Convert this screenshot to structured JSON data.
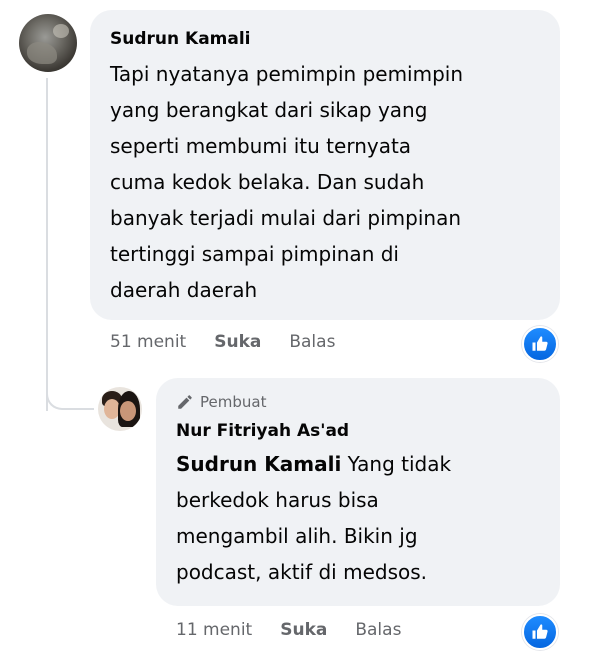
{
  "comment": {
    "author": "Sudrun Kamali",
    "text": "Tapi nyatanya pemimpin pemimpin\nyang berangkat dari sikap yang\nseperti membumi itu ternyata\ncuma kedok belaka. Dan sudah\nbanyak terjadi mulai dari pimpinan\ntertinggi sampai pimpinan di\ndaerah daerah",
    "time": "51 menit",
    "like_label": "Suka",
    "reply_label": "Balas",
    "reaction_icon": "like-icon"
  },
  "reply": {
    "creator_badge": "Pembuat",
    "author": "Nur Fitriyah As'ad",
    "mention": "Sudrun Kamali",
    "text": " Yang tidak\nberkedok harus bisa\nmengambil alih. Bikin jg\npodcast, aktif di medsos.",
    "time": "11 menit",
    "like_label": "Suka",
    "reply_label": "Balas",
    "reaction_icon": "like-icon"
  },
  "colors": {
    "bubble_bg": "#f0f2f5",
    "meta_text": "#65676b",
    "like_blue": "#0866ff"
  }
}
